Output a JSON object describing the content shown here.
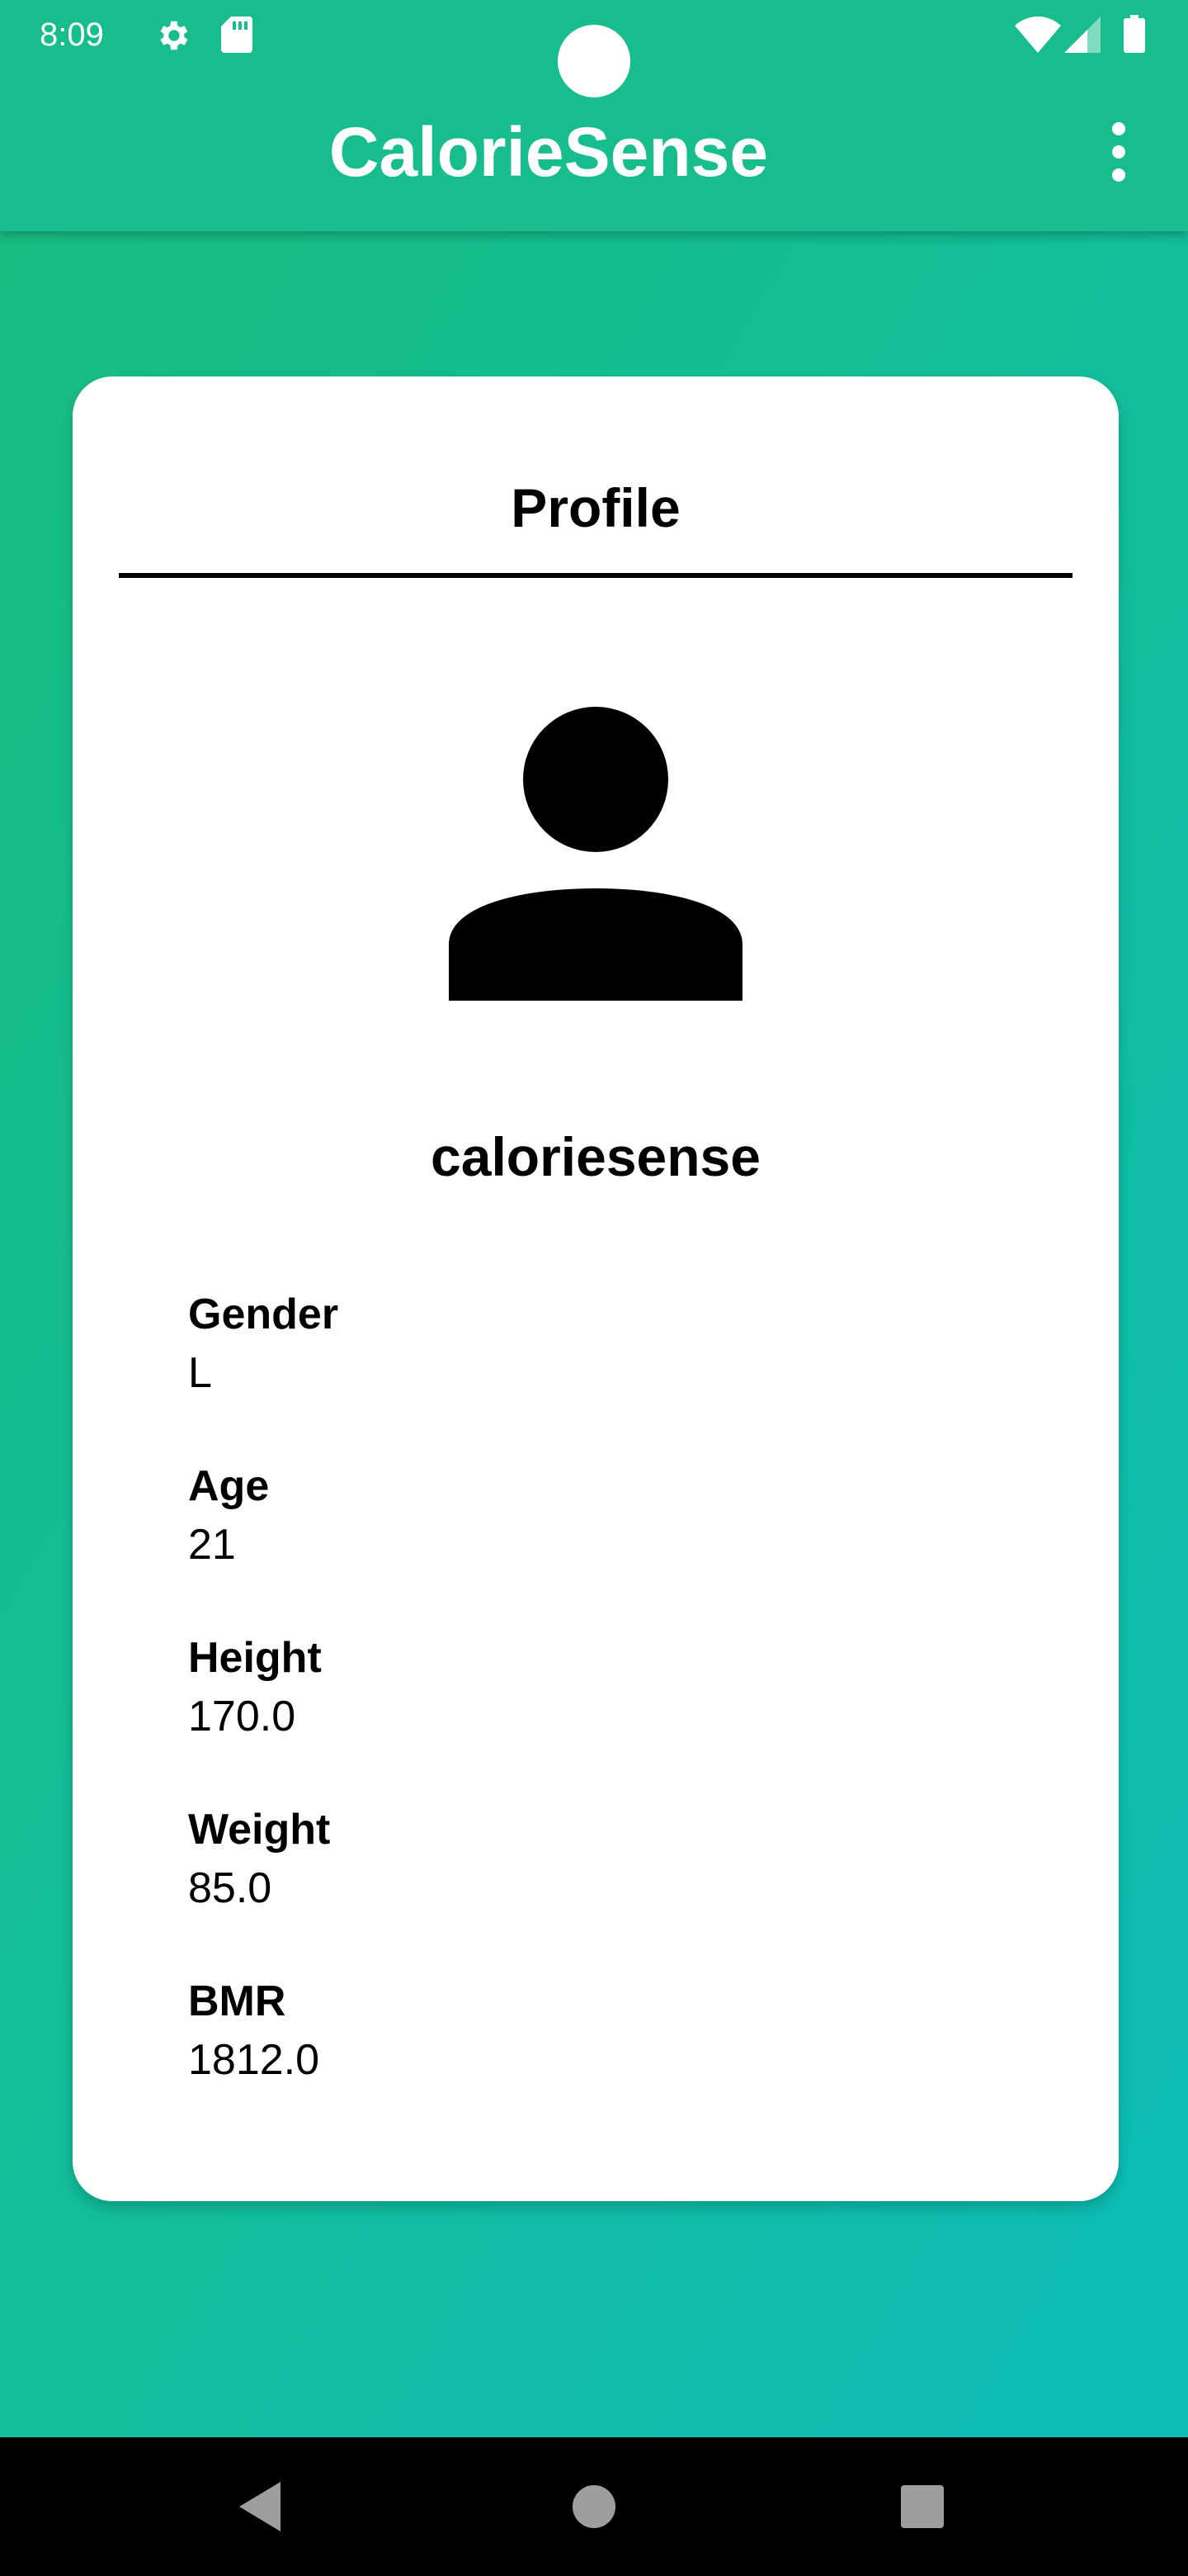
{
  "status_bar": {
    "time": "8:09",
    "icons": [
      "gear-icon",
      "sd-card-icon",
      "camera-cutout",
      "wifi-icon",
      "signal-icon",
      "battery-icon"
    ]
  },
  "app_bar": {
    "title": "CalorieSense",
    "menu_icon": "more-vert-icon"
  },
  "card": {
    "title": "Profile",
    "avatar_icon": "person-icon",
    "username": "caloriesense",
    "fields": [
      {
        "label": "Gender",
        "value": "L"
      },
      {
        "label": "Age",
        "value": "21"
      },
      {
        "label": "Height",
        "value": "170.0"
      },
      {
        "label": "Weight",
        "value": "85.0"
      },
      {
        "label": "BMR",
        "value": "1812.0"
      }
    ]
  },
  "nav_bar": {
    "icons": [
      "back-icon",
      "home-icon",
      "recents-icon"
    ]
  },
  "colors": {
    "gradient_start": "#18bd7e",
    "gradient_end": "#0cbcb9",
    "app_bar": "#18bd8e",
    "card": "#ffffff",
    "text": "#000000",
    "nav_bar": "#000000"
  }
}
